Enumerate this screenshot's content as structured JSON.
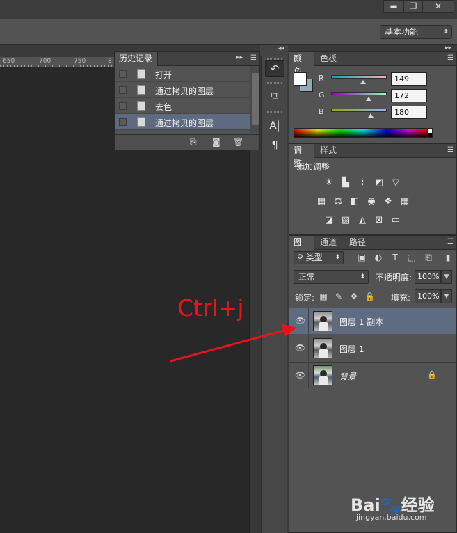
{
  "window": {
    "minimize_glyph": "▬",
    "restore_glyph": "❐",
    "close_glyph": "✕"
  },
  "options_bar": {
    "workspace": "基本功能"
  },
  "ruler": {
    "ticks": [
      "650",
      "700",
      "750",
      "8"
    ]
  },
  "history_panel": {
    "tab": "历史记录",
    "items": [
      {
        "label": "打开",
        "selected": false
      },
      {
        "label": "通过拷贝的图层",
        "selected": false
      },
      {
        "label": "去色",
        "selected": false
      },
      {
        "label": "通过拷贝的图层",
        "selected": true
      }
    ]
  },
  "color_panel": {
    "tabs": [
      "颜色",
      "色板"
    ],
    "foreground": "#ffffff",
    "background": "#95acb4",
    "channels": [
      {
        "name": "R",
        "value": "149",
        "fraction": 0.58,
        "gradient": "linear-gradient(90deg,#00acb4,#ffacb4)"
      },
      {
        "name": "G",
        "value": "172",
        "fraction": 0.67,
        "gradient": "linear-gradient(90deg,#9500b4,#95ffb4)"
      },
      {
        "name": "B",
        "value": "180",
        "fraction": 0.71,
        "gradient": "linear-gradient(90deg,#95ac00,#95acff)"
      }
    ]
  },
  "adjustments_panel": {
    "tabs": [
      "调整",
      "样式"
    ],
    "title": "添加调整",
    "icons_row1": [
      "brightness-icon",
      "levels-icon",
      "curves-icon",
      "exposure-icon",
      "vibrance-icon"
    ],
    "icons_row2": [
      "hue-saturation-icon",
      "color-balance-icon",
      "black-white-icon",
      "photo-filter-icon",
      "channel-mixer-icon",
      "color-lookup-icon"
    ],
    "icons_row3": [
      "invert-icon",
      "posterize-icon",
      "threshold-icon",
      "selective-color-icon",
      "gradient-map-icon"
    ]
  },
  "layers_panel": {
    "tabs": [
      "图层",
      "通道",
      "路径"
    ],
    "kind_filter": "类型",
    "blend_mode": "正常",
    "opacity_label": "不透明度:",
    "opacity": "100%",
    "lock_label": "锁定:",
    "fill_label": "填充:",
    "fill": "100%",
    "layers": [
      {
        "name": "图层 1 副本",
        "selected": true,
        "locked": false,
        "color": false
      },
      {
        "name": "图层 1",
        "selected": false,
        "locked": false,
        "color": false
      },
      {
        "name": "背景",
        "selected": false,
        "locked": true,
        "color": true
      }
    ]
  },
  "annotation": {
    "text": "Ctrl+j",
    "color": "#e8141b"
  },
  "watermark": {
    "logo": "Bai🐾经验",
    "url": "jingyan.baidu.com"
  }
}
